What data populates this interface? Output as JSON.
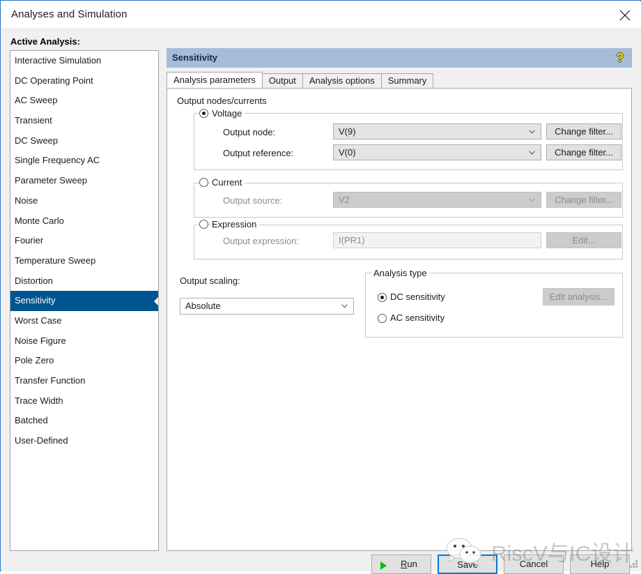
{
  "window": {
    "title": "Analyses and Simulation",
    "close_icon": "close-icon"
  },
  "sidebar": {
    "label": "Active Analysis:",
    "items": [
      {
        "label": "Interactive Simulation",
        "selected": false
      },
      {
        "label": "DC Operating Point",
        "selected": false
      },
      {
        "label": "AC Sweep",
        "selected": false
      },
      {
        "label": "Transient",
        "selected": false
      },
      {
        "label": "DC Sweep",
        "selected": false
      },
      {
        "label": "Single Frequency AC",
        "selected": false
      },
      {
        "label": "Parameter Sweep",
        "selected": false
      },
      {
        "label": "Noise",
        "selected": false
      },
      {
        "label": "Monte Carlo",
        "selected": false
      },
      {
        "label": "Fourier",
        "selected": false
      },
      {
        "label": "Temperature Sweep",
        "selected": false
      },
      {
        "label": "Distortion",
        "selected": false
      },
      {
        "label": "Sensitivity",
        "selected": true
      },
      {
        "label": "Worst Case",
        "selected": false
      },
      {
        "label": "Noise Figure",
        "selected": false
      },
      {
        "label": "Pole Zero",
        "selected": false
      },
      {
        "label": "Transfer Function",
        "selected": false
      },
      {
        "label": "Trace Width",
        "selected": false
      },
      {
        "label": "Batched",
        "selected": false
      },
      {
        "label": "User-Defined",
        "selected": false
      }
    ],
    "selected_color": "#00548f"
  },
  "panel": {
    "title": "Sensitivity",
    "header_color": "#a6bcd8",
    "help_icon": "help-question-icon",
    "help_glyph": "?",
    "tabs": [
      {
        "label": "Analysis parameters",
        "active": true
      },
      {
        "label": "Output",
        "active": false
      },
      {
        "label": "Analysis options",
        "active": false
      },
      {
        "label": "Summary",
        "active": false
      }
    ]
  },
  "output_nodes": {
    "section_label": "Output nodes/currents",
    "voltage": {
      "legend": "Voltage",
      "selected": true,
      "node_label": "Output node:",
      "node_value": "V(9)",
      "node_filter_button": "Change filter...",
      "reference_label": "Output reference:",
      "reference_value": "V(0)",
      "reference_filter_button": "Change filter..."
    },
    "current": {
      "legend": "Current",
      "selected": false,
      "source_label": "Output source:",
      "source_value": "V2",
      "filter_button": "Change filter..."
    },
    "expression": {
      "legend": "Expression",
      "selected": false,
      "expression_label": "Output expression:",
      "expression_value": "I(PR1)",
      "edit_button": "Edit..."
    }
  },
  "output_scaling": {
    "label": "Output scaling:",
    "value": "Absolute"
  },
  "analysis_type": {
    "legend": "Analysis type",
    "options": [
      {
        "label": "DC sensitivity",
        "selected": true
      },
      {
        "label": "AC sensitivity",
        "selected": false
      }
    ],
    "edit_button": "Edit analysis..."
  },
  "footer": {
    "run": "Run",
    "run_accel": "R",
    "run_rest": "un",
    "save": "Save",
    "cancel": "Cancel",
    "help": "Help"
  },
  "watermark": {
    "text": "RiscV与IC设计",
    "logo": "wechat-logo"
  }
}
